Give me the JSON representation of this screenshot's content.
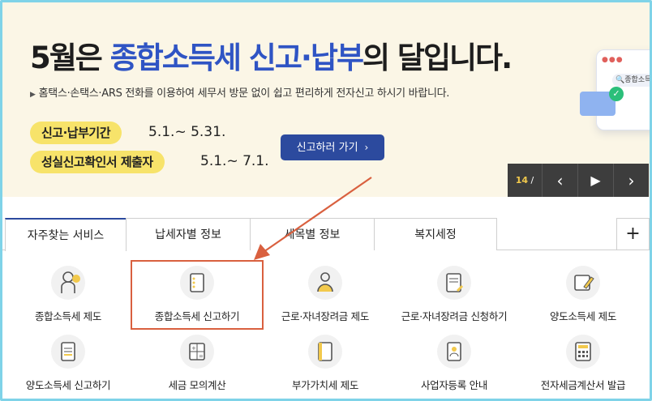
{
  "banner": {
    "title_prefix": "5월은 ",
    "title_highlight": "종합소득세 신고·납부",
    "title_suffix": "의 달입니다.",
    "description": "홈택스·손택스·ARS 전화를 이용하여 세무서 방문 없이 쉽고 편리하게 전자신고 하시기 바랍니다.",
    "items": [
      {
        "label": "신고·납부기간",
        "period": "5.1.~ 5.31."
      },
      {
        "label": "성실신고확인서 제출자",
        "period": "5.1.~ 7.1."
      }
    ],
    "cta_label": "신고하러 가기",
    "illus_text": "종합소득"
  },
  "pager": {
    "current": "14",
    "sep": "/"
  },
  "tabs": [
    "자주찾는 서비스",
    "납세자별 정보",
    "세목별 정보",
    "복지세정"
  ],
  "tab_plus": "+",
  "services": [
    {
      "label": "종합소득세 제도",
      "icon": "person-lightbulb-icon"
    },
    {
      "label": "종합소득세 신고하기",
      "icon": "document-icon"
    },
    {
      "label": "근로·자녀장려금 제도",
      "icon": "family-icon"
    },
    {
      "label": "근로·자녀장려금 신청하기",
      "icon": "document-pen-icon"
    },
    {
      "label": "양도소득세 제도",
      "icon": "edit-icon"
    },
    {
      "label": "양도소득세 신고하기",
      "icon": "list-document-icon"
    },
    {
      "label": "세금 모의계산",
      "icon": "calculator-icon"
    },
    {
      "label": "부가가치세 제도",
      "icon": "book-icon"
    },
    {
      "label": "사업자등록 안내",
      "icon": "id-card-icon"
    },
    {
      "label": "전자세금계산서 발급",
      "icon": "keypad-icon"
    }
  ]
}
